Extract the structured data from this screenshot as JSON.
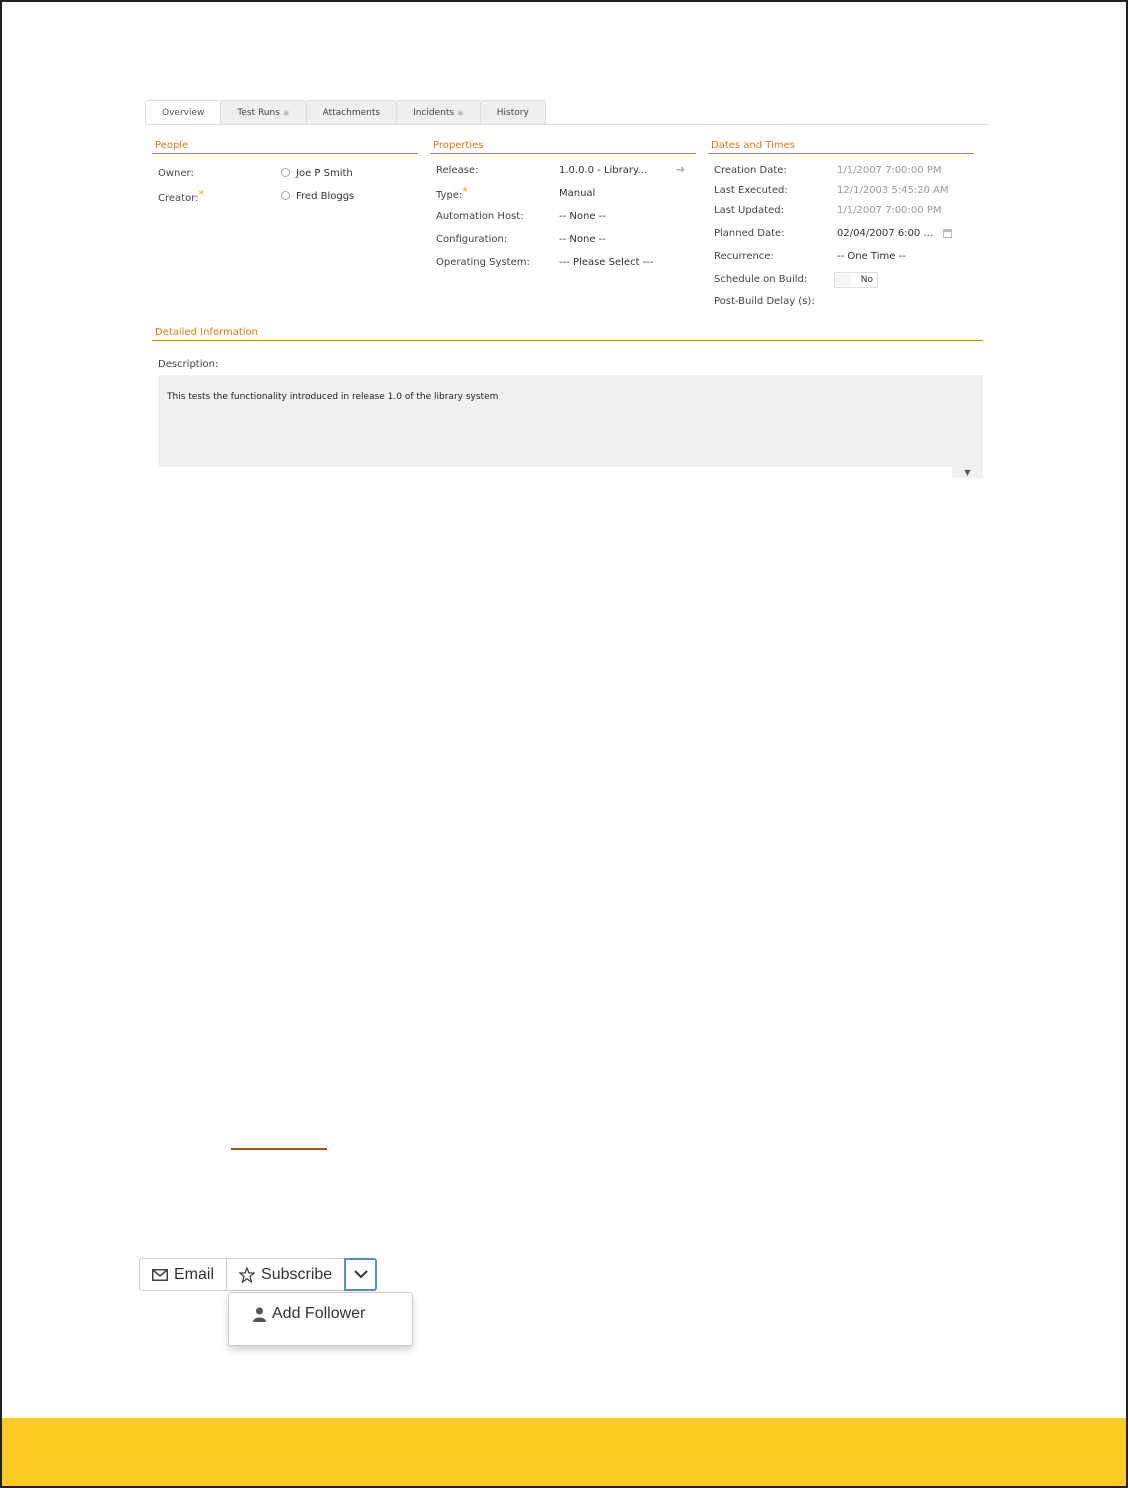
{
  "tabs": [
    {
      "label": "Overview",
      "active": true,
      "has_star": false
    },
    {
      "label": "Test Runs",
      "active": false,
      "has_star": true
    },
    {
      "label": "Attachments",
      "active": false,
      "has_star": false
    },
    {
      "label": "Incidents",
      "active": false,
      "has_star": true
    },
    {
      "label": "History",
      "active": false,
      "has_star": false
    }
  ],
  "people": {
    "title": "People",
    "owner_label": "Owner:",
    "owner_value": "Joe P Smith",
    "creator_label": "Creator:",
    "creator_value": "Fred Bloggs",
    "required_mark": "*"
  },
  "properties": {
    "title": "Properties",
    "release_label": "Release:",
    "release_value": "1.0.0.0 - Library...",
    "type_label": "Type:",
    "type_value": "Manual",
    "automation_host_label": "Automation Host:",
    "automation_host_value": "-- None --",
    "configuration_label": "Configuration:",
    "configuration_value": "-- None --",
    "os_label": "Operating System:",
    "os_value": "--- Please Select ---"
  },
  "dates": {
    "title": "Dates and Times",
    "creation_label": "Creation Date:",
    "creation_value": "1/1/2007 7:00:00 PM",
    "last_executed_label": "Last Executed:",
    "last_executed_value": "12/1/2003 5:45:20 AM",
    "last_updated_label": "Last Updated:",
    "last_updated_value": "1/1/2007 7:00:00 PM",
    "planned_label": "Planned Date:",
    "planned_value": "02/04/2007 6:00 ...",
    "recurrence_label": "Recurrence:",
    "recurrence_value": "-- One Time --",
    "schedule_label": "Schedule on Build:",
    "schedule_value": "No",
    "delay_label": "Post-Build Delay (s):"
  },
  "detailed": {
    "title": "Detailed Information",
    "description_label": "Description:",
    "description_value": "This tests the functionality introduced in release 1.0 of the library system"
  },
  "actions": {
    "email_label": "Email",
    "subscribe_label": "Subscribe",
    "add_follower_label": "Add Follower"
  },
  "colors": {
    "accent": "#e07b12",
    "footer": "#fccb24",
    "dropdown_border": "#5b8ec9"
  }
}
